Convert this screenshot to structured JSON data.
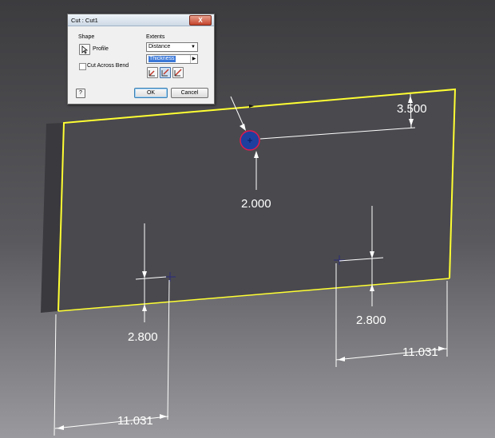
{
  "dialog": {
    "title": "Cut : Cut1",
    "close_label": "X",
    "shape_label": "Shape",
    "profile_label": "Profile",
    "cut_across_bend_label": "Cut Across Bend",
    "extents_label": "Extents",
    "extents_value": "Distance",
    "distance_value": "Thickness",
    "ok_label": "OK",
    "cancel_label": "Cancel",
    "help_label": "?"
  },
  "dimensions": {
    "top_right_offset": "3.500",
    "hole_diameter": "2.000",
    "left_point_y": "2.800",
    "right_point_y": "2.800",
    "right_x": "11.031",
    "left_x": "11.031"
  },
  "colors": {
    "plate": "#4a494e",
    "plate_edge": "#ffff33",
    "hole_fill": "#1f3f9f",
    "hole_ring": "#e01a4f",
    "dimension_lines": "#ffffff"
  }
}
